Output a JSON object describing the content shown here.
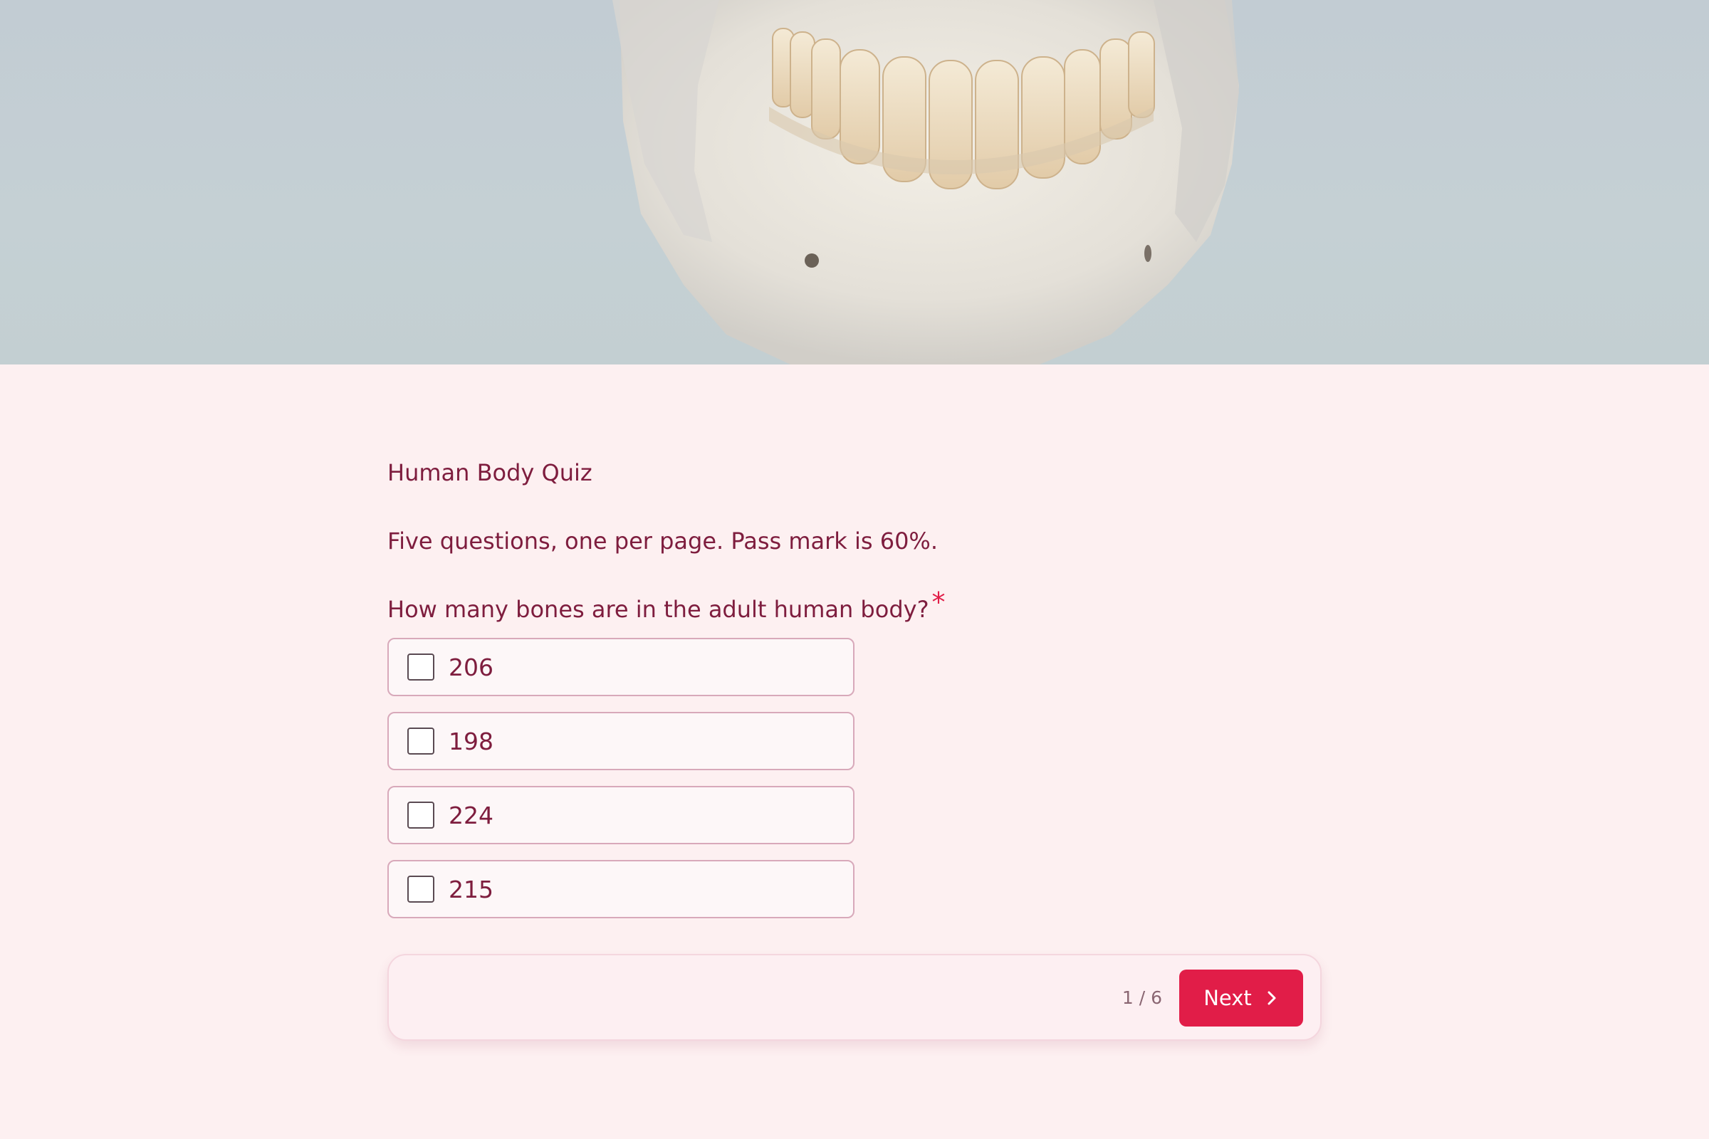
{
  "hero": {
    "image_icon": "skull-jaw-photo"
  },
  "quiz": {
    "title": "Human Body Quiz",
    "description": "Five questions, one per page. Pass mark is 60%.",
    "question": "How many bones are in the adult human body?",
    "required_marker": "*",
    "options": [
      {
        "label": "206",
        "checked": false
      },
      {
        "label": "198",
        "checked": false
      },
      {
        "label": "224",
        "checked": false
      },
      {
        "label": "215",
        "checked": false
      }
    ]
  },
  "footer": {
    "page_indicator": "1 / 6",
    "next_label": "Next",
    "next_icon": "chevron-right-icon"
  },
  "colors": {
    "page_background": "#fdf0f1",
    "text": "#7e1d3e",
    "accent": "#e11d48"
  }
}
